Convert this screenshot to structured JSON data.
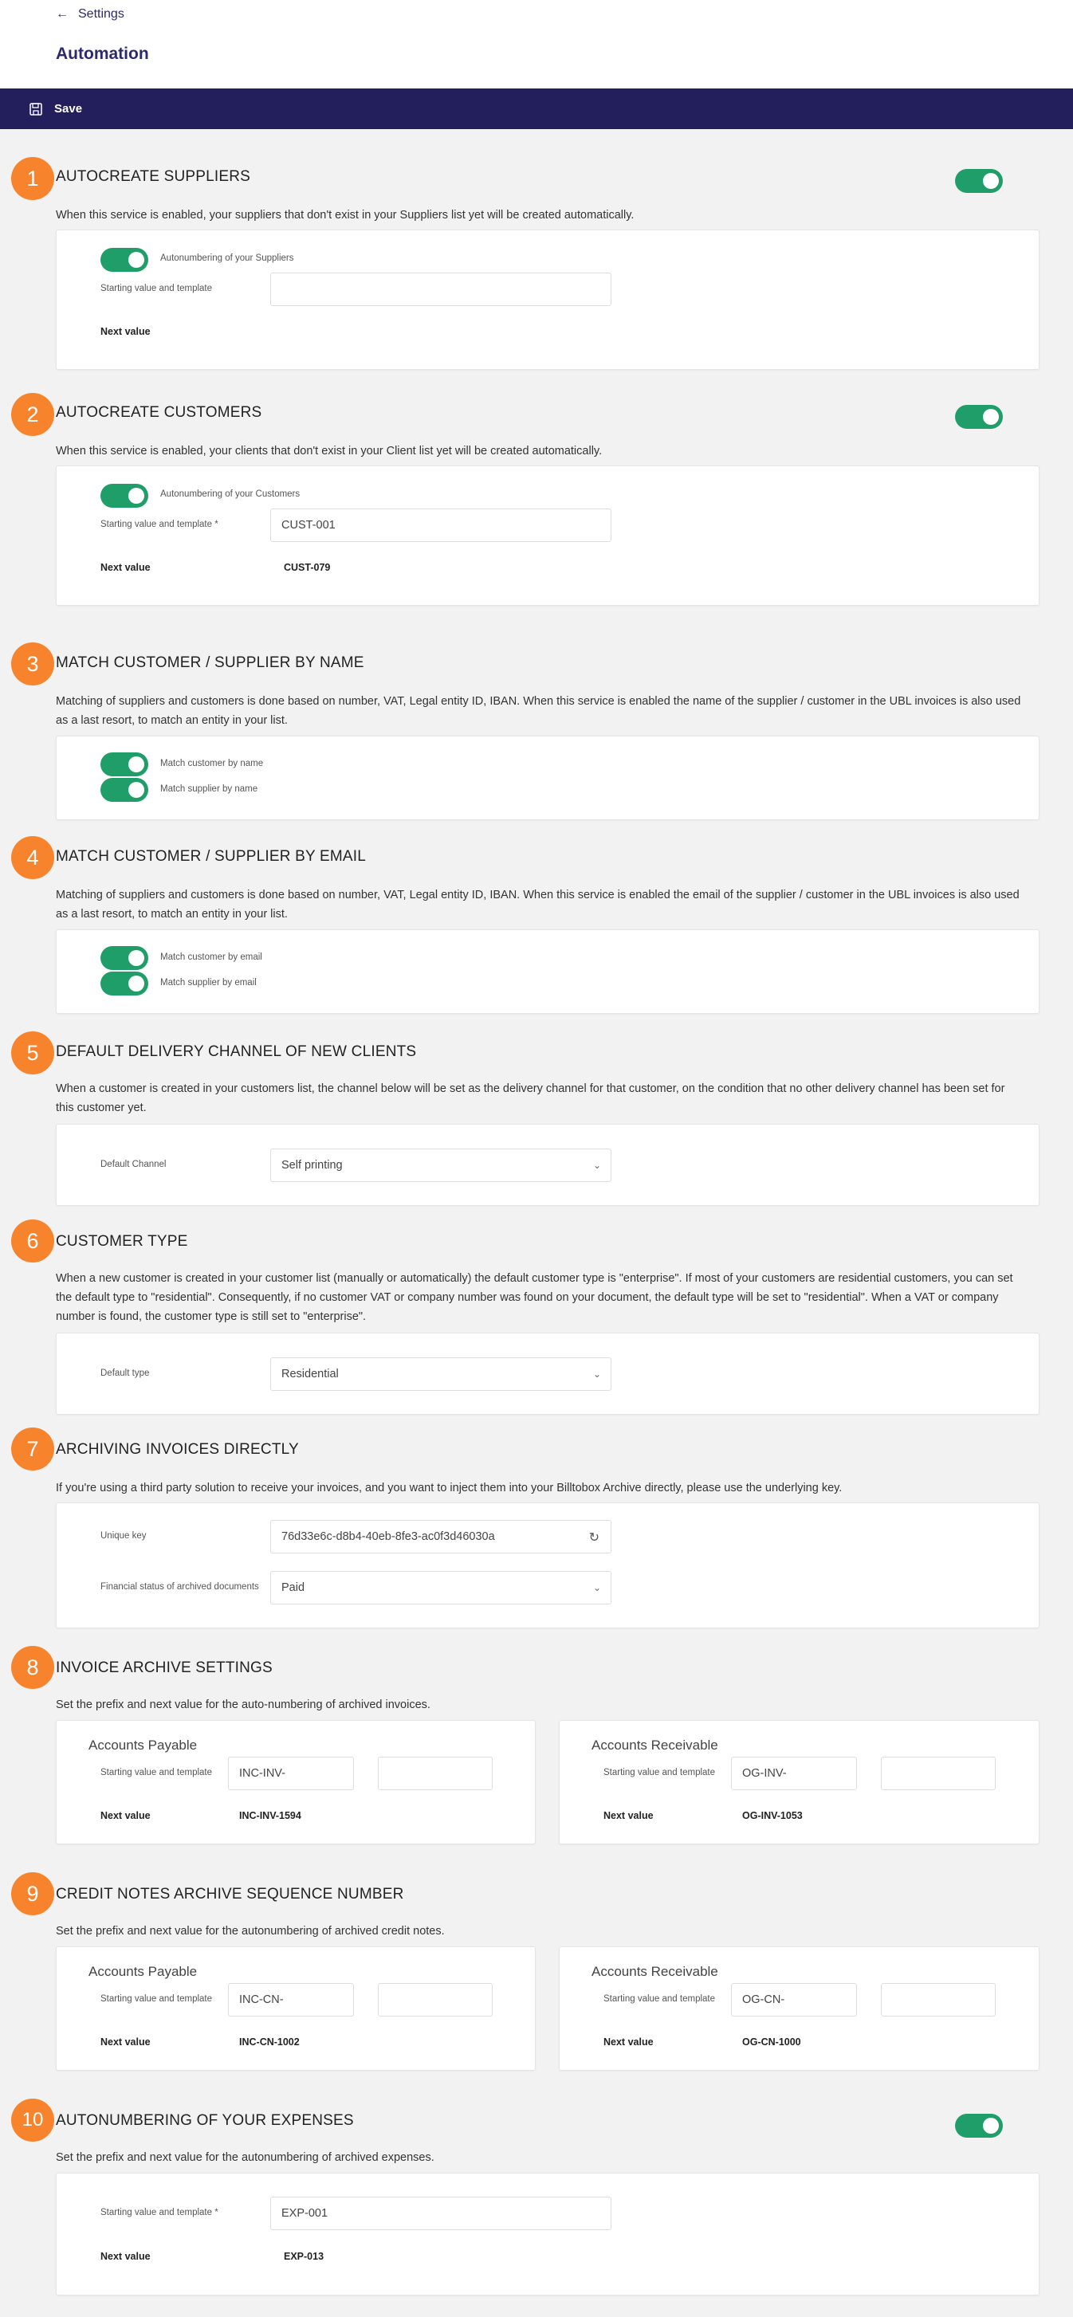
{
  "header": {
    "back_label": "Settings",
    "title": "Automation"
  },
  "toolbar": {
    "save_label": "Save"
  },
  "sections": {
    "s1": {
      "num": "1",
      "title": "AUTOCREATE SUPPLIERS",
      "desc": "When this service is enabled, your suppliers that don't exist in your Suppliers list yet will be created automatically.",
      "enabled": true,
      "autonumber_label": "Autonumbering of your Suppliers",
      "start_label": "Starting value and template",
      "start_value": "",
      "next_label": "Next value",
      "next_value": ""
    },
    "s2": {
      "num": "2",
      "title": "AUTOCREATE CUSTOMERS",
      "desc": "When this service is enabled, your clients that don't exist in your Client list yet will be created automatically.",
      "enabled": true,
      "autonumber_label": "Autonumbering of your Customers",
      "start_label": "Starting value and template *",
      "start_value": "CUST-001",
      "next_label": "Next value",
      "next_value": "CUST-079"
    },
    "s3": {
      "num": "3",
      "title": "MATCH CUSTOMER / SUPPLIER BY NAME",
      "desc_1": "Matching of suppliers and customers is done based on number, VAT, Legal entity ID, IBAN. When this service is enabled the name of the supplier / customer in the UBL invoices is also used",
      "desc_2": "as a last resort, to match an entity in your list.",
      "opt1": "Match customer by name",
      "opt2": "Match supplier by name"
    },
    "s4": {
      "num": "4",
      "title": "MATCH CUSTOMER / SUPPLIER BY EMAIL",
      "desc_1": "Matching of suppliers and customers is done based on number, VAT, Legal entity ID, IBAN. When this service is enabled the email of the supplier / customer in the UBL invoices is also used",
      "desc_2": "as a last resort, to match an entity in your list.",
      "opt1": "Match customer by email",
      "opt2": "Match supplier by email"
    },
    "s5": {
      "num": "5",
      "title": "DEFAULT DELIVERY CHANNEL OF NEW CLIENTS",
      "desc_1": "When a customer is created in your customers list, the channel below will be set as the delivery channel for that customer, on the condition that no other delivery channel has been set for",
      "desc_2": "this customer yet.",
      "field_label": "Default Channel",
      "field_value": "Self printing"
    },
    "s6": {
      "num": "6",
      "title": "CUSTOMER TYPE",
      "desc_1": "When a new customer is created in your customer list (manually or automatically) the default customer type is \"enterprise\". If most of your customers are residential customers, you can set",
      "desc_2": "the default type to \"residential\". Consequently, if no customer VAT or company number was found on your document, the default type will be set to \"residential\". When a VAT or company",
      "desc_3": "number is found, the customer type is still set to \"enterprise\".",
      "field_label": "Default type",
      "field_value": "Residential"
    },
    "s7": {
      "num": "7",
      "title": "ARCHIVING INVOICES DIRECTLY",
      "desc": "If you're using a third party solution to receive your invoices, and you want to inject them into your Billtobox Archive directly, please use the underlying key.",
      "key_label": "Unique key",
      "key_value": "76d33e6c-d8b4-40eb-8fe3-ac0f3d46030a",
      "status_label": "Financial status of archived documents",
      "status_value": "Paid"
    },
    "s8": {
      "num": "8",
      "title": "INVOICE ARCHIVE SETTINGS",
      "desc": "Set the prefix and next value for the auto-numbering of archived invoices.",
      "ap": {
        "heading": "Accounts Payable",
        "start_label": "Starting value and template",
        "prefix": "INC-INV-",
        "value": "",
        "next_label": "Next value",
        "next_value": "INC-INV-1594"
      },
      "ar": {
        "heading": "Accounts Receivable",
        "start_label": "Starting value and template",
        "prefix": "OG-INV-",
        "value": "",
        "next_label": "Next value",
        "next_value": "OG-INV-1053"
      }
    },
    "s9": {
      "num": "9",
      "title": "CREDIT NOTES ARCHIVE SEQUENCE NUMBER",
      "desc": "Set the prefix and next value for the autonumbering of archived credit notes.",
      "ap": {
        "heading": "Accounts Payable",
        "start_label": "Starting value and template",
        "prefix": "INC-CN-",
        "value": "",
        "next_label": "Next value",
        "next_value": "INC-CN-1002"
      },
      "ar": {
        "heading": "Accounts Receivable",
        "start_label": "Starting value and template",
        "prefix": "OG-CN-",
        "value": "",
        "next_label": "Next value",
        "next_value": "OG-CN-1000"
      }
    },
    "s10": {
      "num": "10",
      "title": "AUTONUMBERING OF YOUR EXPENSES",
      "desc": "Set the prefix and next value for the autonumbering of archived expenses.",
      "enabled": true,
      "start_label": "Starting value and template *",
      "start_value": "EXP-001",
      "next_label": "Next value",
      "next_value": "EXP-013"
    }
  },
  "colors": {
    "accent": "#f7842d",
    "toggle_on": "#1f9e6a",
    "toolbar": "#231f5c",
    "title": "#2c2a6e"
  }
}
